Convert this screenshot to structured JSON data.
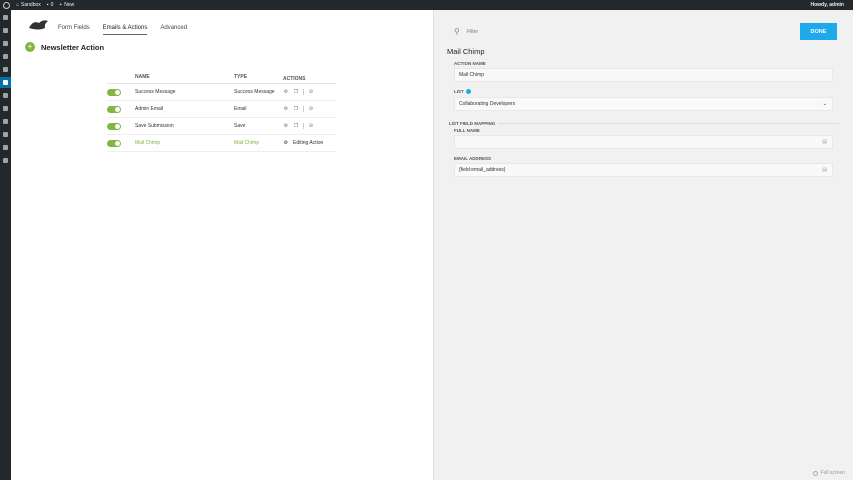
{
  "adminbar": {
    "site_name": "Sandbox",
    "comments_count": "0",
    "new_label": "New",
    "howdy": "Howdy, admin"
  },
  "builder": {
    "tabs": [
      {
        "label": "Form Fields"
      },
      {
        "label": "Emails & Actions"
      },
      {
        "label": "Advanced"
      }
    ],
    "active_tab": "Emails & Actions",
    "form_title": "Newsletter Action",
    "table": {
      "headers": [
        "NAME",
        "TYPE",
        "ACTIONS"
      ],
      "rows": [
        {
          "name": "Success Message",
          "type": "Success Message",
          "enabled": true
        },
        {
          "name": "Admin Email",
          "type": "Email",
          "enabled": true
        },
        {
          "name": "Save Submission",
          "type": "Save",
          "enabled": true
        },
        {
          "name": "Mail Chimp",
          "type": "Mail Chimp",
          "enabled": true,
          "editing_label": "Editing Action"
        }
      ]
    }
  },
  "drawer": {
    "search_placeholder": "Filter",
    "done_label": "DONE",
    "title": "Mail Chimp",
    "action_name_label": "ACTION NAME",
    "action_name_value": "Mail Chimp",
    "list_label": "LIST",
    "list_value": "Collaborating Developers",
    "mapping_label": "LIST FIELD MAPPING",
    "full_name_label": "FULL NAME",
    "full_name_value": "",
    "email_label": "EMAIL ADDRESS",
    "email_value": "{field:email_address}",
    "fullscreen_label": "Full screen"
  },
  "colors": {
    "accent_green": "#82b541",
    "done_blue": "#1ea9ea",
    "admin_dark": "#23282d",
    "menu_active": "#0073aa"
  }
}
